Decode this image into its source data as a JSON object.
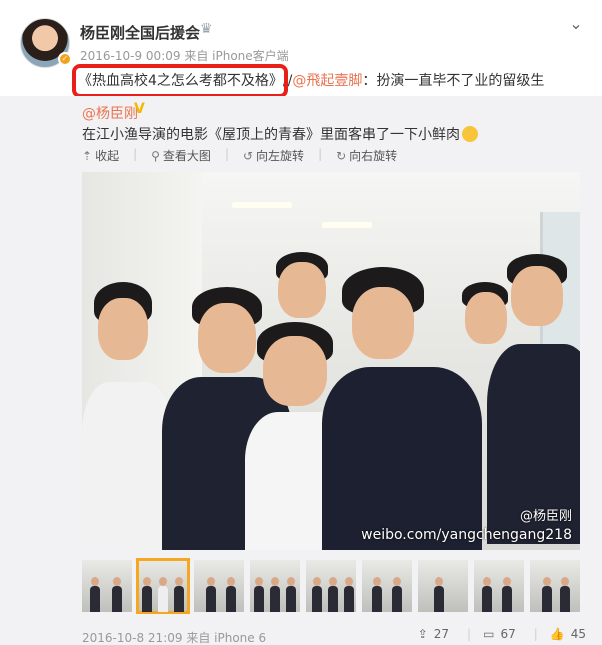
{
  "post": {
    "username": "杨臣刚全国后援会",
    "timestamp": "2016-10-9 00:09",
    "source": "来自 iPhone客户端",
    "text_highlight": "《热血高校4之怎么考都不及格》",
    "text_sep": "//",
    "mention": "@飛起壹脚",
    "text_rest": "：扮演一直毕不了业的留级生"
  },
  "repost": {
    "user": "@杨臣刚",
    "text": "在江小渔导演的电影《屋顶上的青春》里面客串了一下小鲜肉",
    "actions": [
      {
        "icon": "collapse-icon",
        "glyph": "⇡",
        "label": "收起"
      },
      {
        "icon": "magnify-icon",
        "glyph": "⚲",
        "label": "查看大图"
      },
      {
        "icon": "rotate-left-icon",
        "glyph": "↺",
        "label": "向左旋转"
      },
      {
        "icon": "rotate-right-icon",
        "glyph": "↻",
        "label": "向右旋转"
      }
    ],
    "watermark_user": "@杨臣刚",
    "watermark_url": "weibo.com/yangchengang218",
    "footer_time": "2016-10-8 21:09",
    "footer_source": "来自 iPhone 6",
    "stats": {
      "reposts": "27",
      "comments": "67",
      "likes": "45"
    }
  },
  "colors": {
    "accent": "#eb7350",
    "highlight_border": "#e8201a",
    "repost_bg": "#f2f2f5",
    "selected_thumb": "#f5a623"
  },
  "icons": {
    "vip": "crown-icon",
    "menu": "chevron-down-icon",
    "verified": "verified-v-icon",
    "repost": "share-icon",
    "comment": "comment-icon",
    "like": "thumbs-up-icon"
  }
}
